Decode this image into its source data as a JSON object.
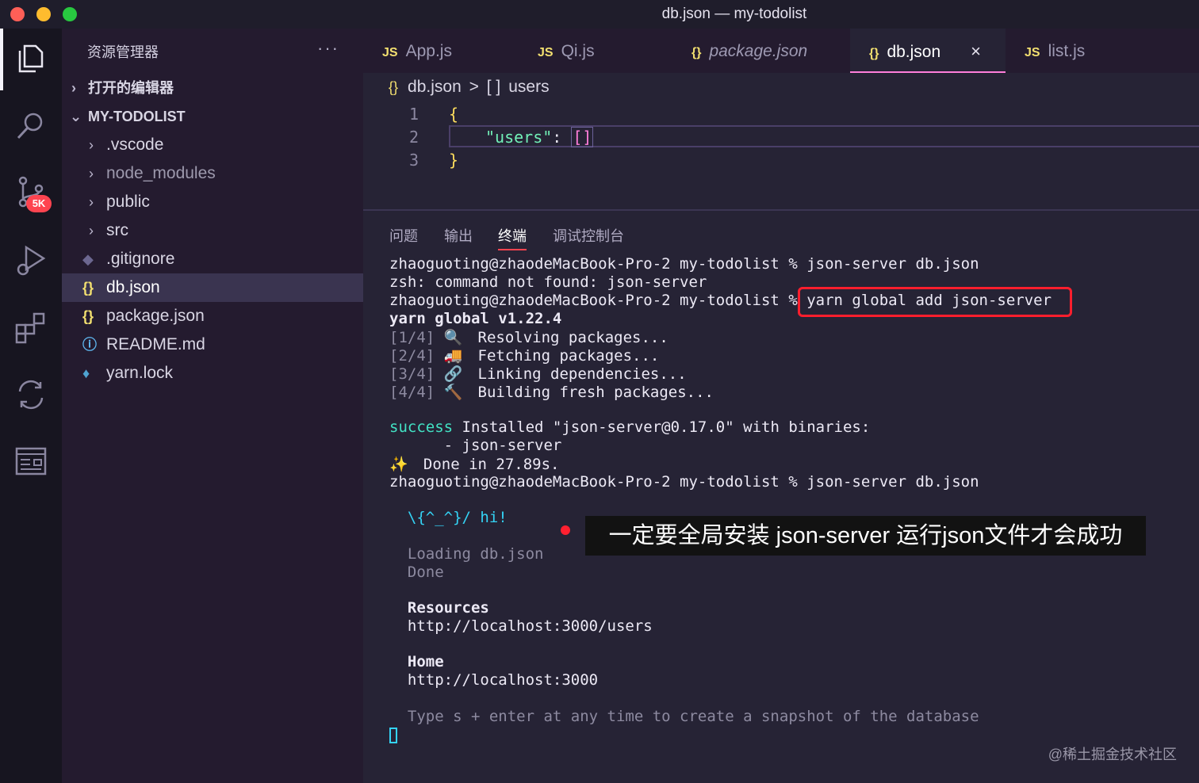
{
  "window": {
    "title": "db.json — my-todolist"
  },
  "sidebar": {
    "header": "资源管理器",
    "more": "···",
    "open_editors": "打开的编辑器",
    "project": "MY-TODOLIST",
    "items": [
      {
        "label": ".vscode",
        "type": "folder"
      },
      {
        "label": "node_modules",
        "type": "folder"
      },
      {
        "label": "public",
        "type": "folder"
      },
      {
        "label": "src",
        "type": "folder"
      },
      {
        "label": ".gitignore",
        "type": "file",
        "icon": "git-icon"
      },
      {
        "label": "db.json",
        "type": "file",
        "icon": "json-icon"
      },
      {
        "label": "package.json",
        "type": "file",
        "icon": "json-icon"
      },
      {
        "label": "README.md",
        "type": "file",
        "icon": "info-icon"
      },
      {
        "label": "yarn.lock",
        "type": "file",
        "icon": "yarn-icon"
      }
    ]
  },
  "activity_bar": {
    "scm_badge": "5K"
  },
  "tabs": [
    {
      "icon": "JS",
      "label": "App.js"
    },
    {
      "icon": "JS",
      "label": "Qi.js"
    },
    {
      "icon": "{}",
      "label": "package.json"
    },
    {
      "icon": "{}",
      "label": "db.json",
      "active": true,
      "close": "×"
    },
    {
      "icon": "JS",
      "label": "list.js"
    }
  ],
  "breadcrumb": {
    "icon": "{}",
    "file": "db.json",
    "sep": ">",
    "node_icon": "[ ]",
    "node": "users"
  },
  "editor": {
    "line_numbers": [
      "1",
      "2",
      "3"
    ],
    "line1": "{",
    "line2_key": "\"users\"",
    "line2_colon": ":",
    "line2_value": "[]",
    "line3": "}"
  },
  "panel": {
    "tabs": [
      "问题",
      "输出",
      "终端",
      "调试控制台"
    ],
    "active_tab": "终端"
  },
  "terminal": {
    "l1": "zhaoguoting@zhaodeMacBook-Pro-2 my-todolist % json-server db.json",
    "l2": "zsh: command not found: json-server",
    "l3": "zhaoguoting@zhaodeMacBook-Pro-2 my-todolist % yarn global add json-server",
    "l4": "yarn global v1.22.4",
    "steps": [
      {
        "n": "[1/4]",
        "emoji": "🔍",
        "text": "Resolving packages..."
      },
      {
        "n": "[2/4]",
        "emoji": "🚚",
        "text": "Fetching packages..."
      },
      {
        "n": "[3/4]",
        "emoji": "🔗",
        "text": "Linking dependencies..."
      },
      {
        "n": "[4/4]",
        "emoji": "🔨",
        "text": "Building fresh packages..."
      }
    ],
    "success_word": "success",
    "success_rest": " Installed \"json-server@0.17.0\" with binaries:",
    "bin": "      - json-server",
    "done_emoji": "✨",
    "done": "  Done in 27.89s.",
    "l5": "zhaoguoting@zhaodeMacBook-Pro-2 my-todolist % json-server db.json",
    "hi": "  \\{^_^}/ hi!",
    "loading": "  Loading db.json",
    "loading_done": "  Done",
    "resources": "  Resources",
    "resources_url": "  http://localhost:3000/users",
    "home": "  Home",
    "home_url": "  http://localhost:3000",
    "hint": "  Type s + enter at any time to create a snapshot of the database"
  },
  "annotation": "一定要全局安装 json-server 运行json文件才会成功",
  "watermark": "@稀土掘金技术社区",
  "colors": {
    "accent": "#ff7edb",
    "annotation_box": "#ff1e2d",
    "success": "#42e2c4",
    "hi": "#34d3f5"
  }
}
